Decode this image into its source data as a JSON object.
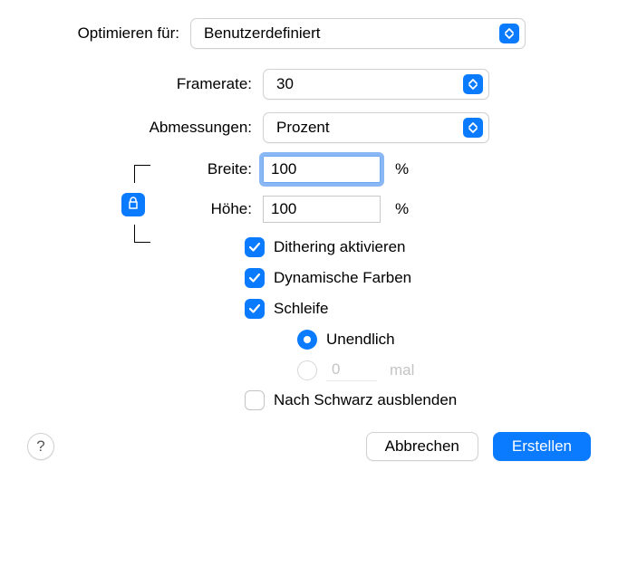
{
  "labels": {
    "optimize": "Optimieren für:",
    "framerate": "Framerate:",
    "dimensions": "Abmessungen:",
    "width": "Breite:",
    "height": "Höhe:"
  },
  "optimize_value": "Benutzerdefiniert",
  "framerate_value": "30",
  "dimensions_value": "Prozent",
  "width_value": "100",
  "height_value": "100",
  "unit_percent": "%",
  "checkboxes": {
    "dithering": "Dithering aktivieren",
    "dynamic_colors": "Dynamische Farben",
    "loop": "Schleife"
  },
  "radio": {
    "infinite": "Unendlich",
    "times_value": "0",
    "times_suffix": "mal"
  },
  "fade_label": "Nach Schwarz ausblenden",
  "help": "?",
  "buttons": {
    "cancel": "Abbrechen",
    "create": "Erstellen"
  }
}
